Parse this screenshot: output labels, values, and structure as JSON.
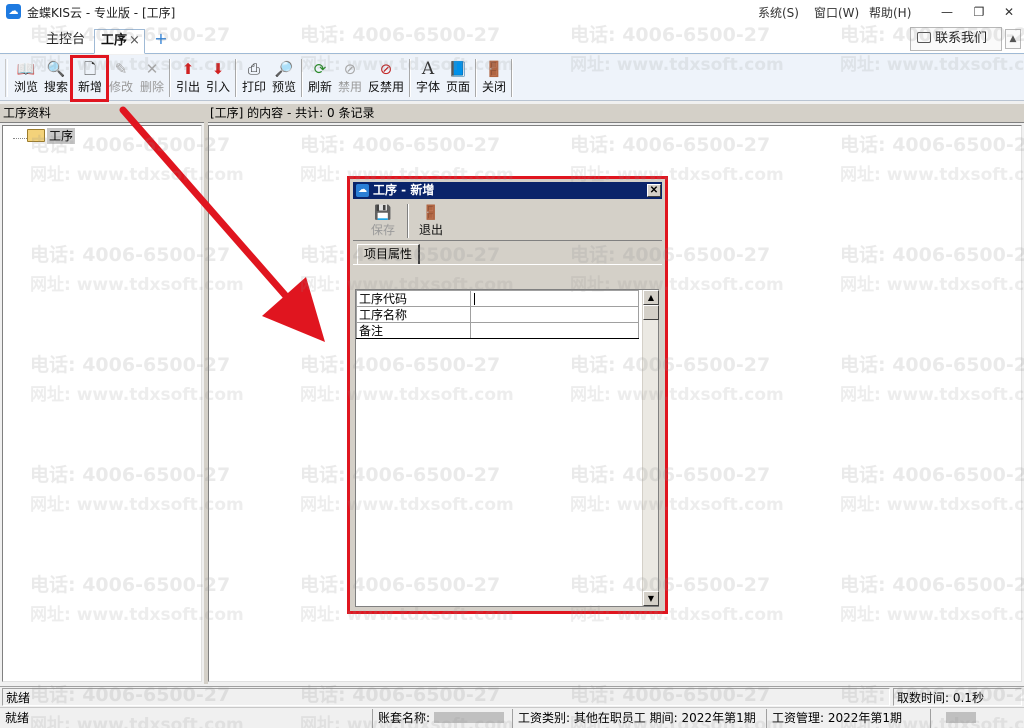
{
  "window": {
    "title": "金蝶KIS云 - 专业版 - [工序]",
    "menus": [
      "系统(S)",
      "窗口(W)",
      "帮助(H)"
    ],
    "controls": {
      "minimize": "—",
      "restore": "❐",
      "close": "✕"
    }
  },
  "tabs": {
    "home": "主控台",
    "active": "工序",
    "close": "×",
    "add": "+",
    "contact": "联系我们",
    "collapse": "▲"
  },
  "toolbar": {
    "browse": "浏览",
    "search": "搜索",
    "new": "新增",
    "modify": "修改",
    "delete": "删除",
    "export": "引出",
    "import": "引入",
    "print": "打印",
    "preview": "预览",
    "refresh": "刷新",
    "disable": "禁用",
    "undisable": "反禁用",
    "font": "字体",
    "page": "页面",
    "close": "关闭"
  },
  "left_panel": {
    "header": "工序资料",
    "tree_root": "工序"
  },
  "right_panel": {
    "header": "[工序] 的内容 - 共计: 0 条记录"
  },
  "dialog": {
    "title": "工序 - 新增",
    "close": "✕",
    "save": "保存",
    "exit": "退出",
    "tab": "项目属性",
    "fields": [
      {
        "label": "工序代码",
        "value": ""
      },
      {
        "label": "工序名称",
        "value": ""
      },
      {
        "label": "备注",
        "value": ""
      }
    ],
    "scroll_up": "▲",
    "scroll_down": "▼"
  },
  "status": {
    "ready1": "就绪",
    "fetch_time": "取数时间: 0.1秒",
    "ready2": "就绪",
    "account_label": "账套名称:",
    "wage_type": "工资类别: 其他在职员工 期间: 2022年第1期",
    "wage_mgmt": "工资管理: 2022年第1期"
  },
  "watermark": {
    "phone": "电话: 4006-6500-27",
    "site": "网址: www.tdxsoft.com"
  },
  "colors": {
    "accent_red": "#e0151f",
    "dialog_title": "#0a246a",
    "tab_accent": "#2b7fd6"
  }
}
